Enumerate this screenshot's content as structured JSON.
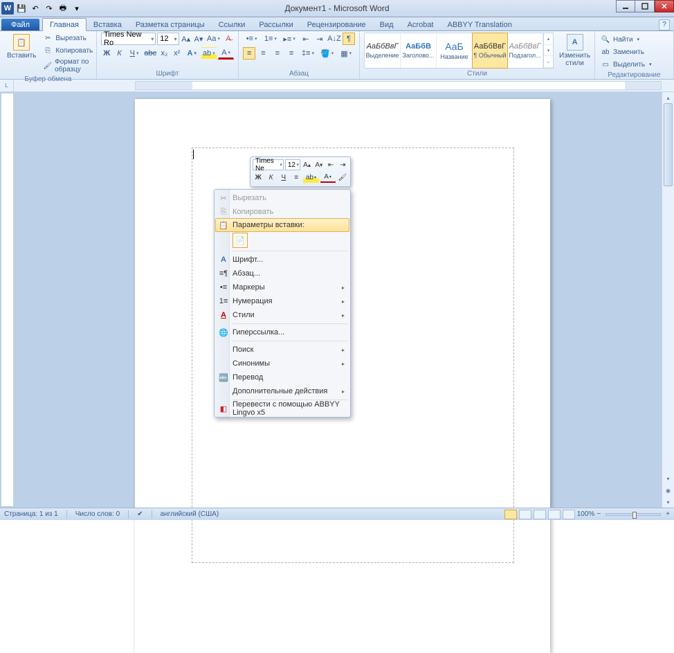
{
  "title": "Документ1 - Microsoft Word",
  "tabs": {
    "file": "Файл",
    "items": [
      "Главная",
      "Вставка",
      "Разметка страницы",
      "Ссылки",
      "Рассылки",
      "Рецензирование",
      "Вид",
      "Acrobat",
      "ABBYY Translation"
    ],
    "active_index": 0
  },
  "clipboard": {
    "paste": "Вставить",
    "cut": "Вырезать",
    "copy": "Копировать",
    "format_painter": "Формат по образцу",
    "group": "Буфер обмена"
  },
  "font": {
    "name": "Times New Ro",
    "size": "12",
    "group": "Шрифт"
  },
  "paragraph": {
    "group": "Абзац"
  },
  "styles": {
    "group": "Стили",
    "items": [
      {
        "preview": "АаБбВвГ",
        "label": "Выделение"
      },
      {
        "preview": "АаБбВ",
        "label": "Заголово..."
      },
      {
        "preview": "АаБ",
        "label": "Название"
      },
      {
        "preview": "АаБбВвГ",
        "label": "¶ Обычный"
      },
      {
        "preview": "АаБбВвГ",
        "label": "Подзагол..."
      }
    ],
    "selected_index": 3,
    "change_styles": "Изменить\nстили"
  },
  "editing": {
    "group": "Редактирование",
    "find": "Найти",
    "replace": "Заменить",
    "select": "Выделить"
  },
  "mini_toolbar": {
    "font": "Times Ne",
    "size": "12"
  },
  "context_menu": {
    "cut": "Вырезать",
    "copy": "Копировать",
    "paste_options": "Параметры вставки:",
    "font": "Шрифт...",
    "paragraph": "Абзац...",
    "bullets": "Маркеры",
    "numbering": "Нумерация",
    "styles": "Стили",
    "hyperlink": "Гиперссылка...",
    "search": "Поиск",
    "synonyms": "Синонимы",
    "translate": "Перевод",
    "additional": "Дополнительные действия",
    "abbyy": "Перевести с помощью ABBYY Lingvo x5"
  },
  "statusbar": {
    "page": "Страница: 1 из 1",
    "words": "Число слов: 0",
    "language": "английский (США)",
    "zoom": "100%"
  }
}
